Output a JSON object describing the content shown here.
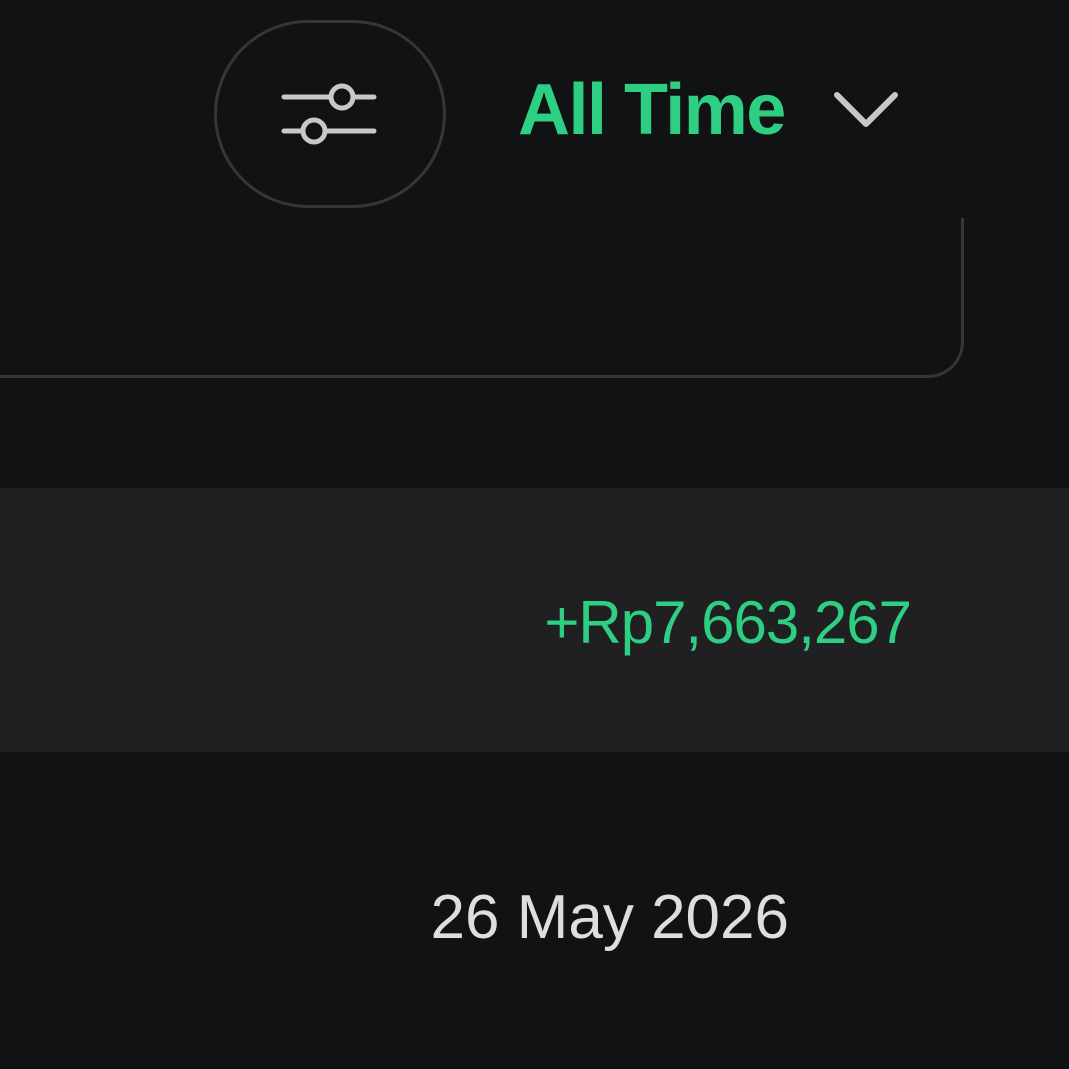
{
  "toolbar": {
    "filter_icon": "sliders-icon",
    "period": {
      "selected": "All Time",
      "icon": "chevron-down-icon"
    }
  },
  "summary": {
    "amount": "+Rp7,663,267"
  },
  "group": {
    "date": "26 May 2026"
  },
  "colors": {
    "background": "#111213",
    "row_background": "#202022",
    "accent_green": "#2ecf82",
    "border": "#343638",
    "text": "#dedede"
  }
}
